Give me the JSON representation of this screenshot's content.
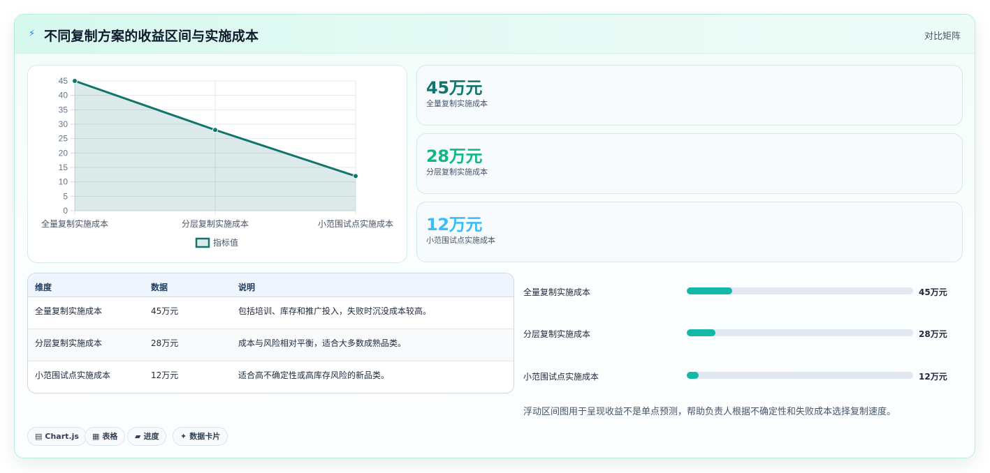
{
  "header": {
    "title": "不同复制方案的收益区间与实施成本",
    "badge": "对比矩阵",
    "icon": "lightning-icon"
  },
  "chart_data": {
    "type": "area",
    "categories": [
      "全量复制实施成本",
      "分层复制实施成本",
      "小范围试点实施成本"
    ],
    "series": [
      {
        "name": "指标值",
        "values": [
          45,
          28,
          12
        ],
        "color": "#12756b"
      }
    ],
    "ylim": [
      0,
      45
    ],
    "yticks": [
      0,
      5,
      10,
      15,
      20,
      25,
      30,
      35,
      40,
      45
    ],
    "grid": true,
    "legend": "bottom"
  },
  "stats": [
    {
      "value": "45万元",
      "label": "全量复制实施成本",
      "color": "#0f766e"
    },
    {
      "value": "28万元",
      "label": "分层复制实施成本",
      "color": "#10b981"
    },
    {
      "value": "12万元",
      "label": "小范围试点实施成本",
      "color": "#38bdf8"
    }
  ],
  "table": {
    "headers": [
      "维度",
      "数据",
      "说明"
    ],
    "rows": [
      [
        "全量复制实施成本",
        "45万元",
        "包括培训、库存和推广投入，失败时沉没成本较高。"
      ],
      [
        "分层复制实施成本",
        "28万元",
        "成本与风险相对平衡，适合大多数成熟品类。"
      ],
      [
        "小范围试点实施成本",
        "12万元",
        "适合高不确定性或高库存风险的新品类。"
      ]
    ]
  },
  "progress": [
    {
      "label": "全量复制实施成本",
      "value": "45万元",
      "fraction": 0.2
    },
    {
      "label": "分层复制实施成本",
      "value": "28万元",
      "fraction": 0.125
    },
    {
      "label": "小范围试点实施成本",
      "value": "12万元",
      "fraction": 0.054
    }
  ],
  "note": "浮动区间图用于呈现收益不是单点预测，帮助负责人根据不确定性和失败成本选择复制速度。",
  "chips": [
    {
      "icon": "▤",
      "label": "Chart.js"
    },
    {
      "icon": "▦",
      "label": "表格"
    },
    {
      "icon": "▰",
      "label": "进度"
    },
    {
      "icon": "✦",
      "label": "数据卡片"
    }
  ]
}
